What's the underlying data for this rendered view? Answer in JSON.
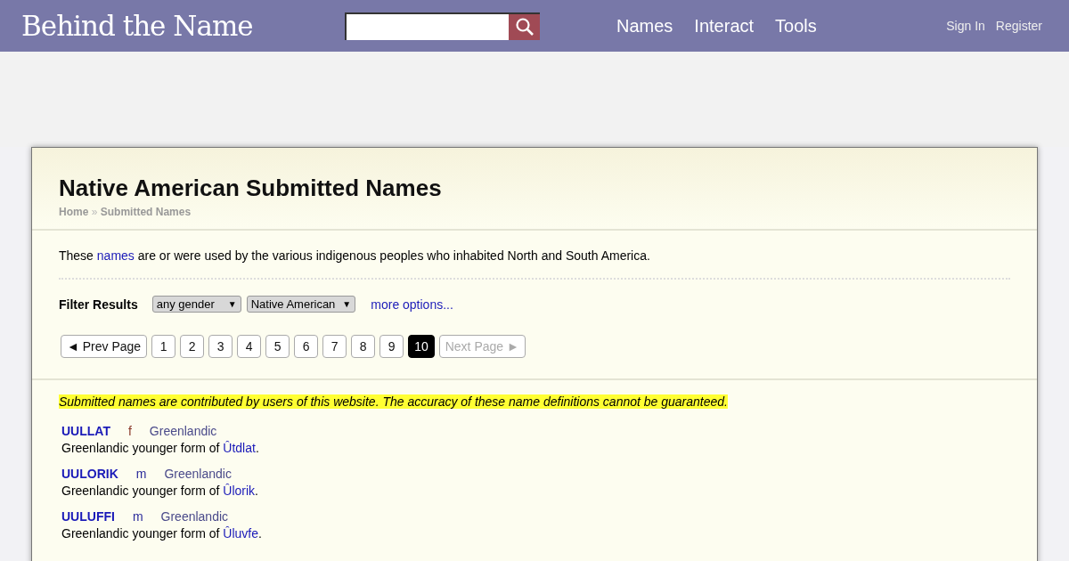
{
  "header": {
    "logo": "Behind the Name",
    "nav": [
      "Names",
      "Interact",
      "Tools"
    ],
    "account": [
      "Sign In",
      "Register"
    ]
  },
  "page": {
    "title": "Native American Submitted Names",
    "breadcrumb": [
      "Home",
      "Submitted Names"
    ],
    "breadcrumb_separator": "»",
    "intro": {
      "before": "These ",
      "link": "names",
      "after": " are or were used by the various indigenous peoples who inhabited North and South America."
    },
    "filter": {
      "label": "Filter Results",
      "selects": [
        {
          "value": "any gender",
          "arrow": "▼"
        },
        {
          "value": "Native American",
          "arrow": "▼"
        }
      ],
      "more": "more options..."
    },
    "pagination": [
      {
        "label": "◄ Prev Page",
        "selected": false,
        "disabled": false
      },
      {
        "label": "1",
        "selected": false,
        "disabled": false
      },
      {
        "label": "2",
        "selected": false,
        "disabled": false
      },
      {
        "label": "3",
        "selected": false,
        "disabled": false
      },
      {
        "label": "4",
        "selected": false,
        "disabled": false
      },
      {
        "label": "5",
        "selected": false,
        "disabled": false
      },
      {
        "label": "6",
        "selected": false,
        "disabled": false
      },
      {
        "label": "7",
        "selected": false,
        "disabled": false
      },
      {
        "label": "8",
        "selected": false,
        "disabled": false
      },
      {
        "label": "9",
        "selected": false,
        "disabled": false
      },
      {
        "label": "10",
        "selected": true,
        "disabled": false
      },
      {
        "label": "Next Page ►",
        "selected": false,
        "disabled": true
      }
    ],
    "notice": "Submitted names are contributed by users of this website. The accuracy of these name definitions cannot be guaranteed.",
    "entries": [
      {
        "name": "UULLAT",
        "gender": "f",
        "kind": "feminine",
        "usage": "Greenlandic",
        "definition": "Greenlandic younger form of ",
        "link": "Ûtdlat",
        "end": "."
      },
      {
        "name": "UULORIK",
        "gender": "m",
        "kind": "masculine",
        "usage": "Greenlandic",
        "definition": "Greenlandic younger form of ",
        "link": "Ûlorik",
        "end": "."
      },
      {
        "name": "UULUFFI",
        "gender": "m",
        "kind": "masculine",
        "usage": "Greenlandic",
        "definition": "Greenlandic younger form of ",
        "link": "Ûluvfe",
        "end": "."
      }
    ]
  }
}
